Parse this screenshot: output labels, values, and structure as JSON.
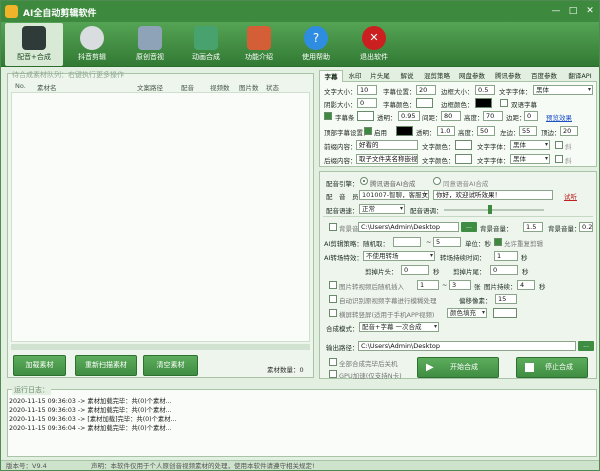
{
  "app": {
    "title": "AI全自动剪辑软件"
  },
  "toolbar": [
    {
      "label": "配音+合成",
      "icon": "clapperboard-icon",
      "color": "#2f3b38"
    },
    {
      "label": "抖音剪辑",
      "icon": "palette-icon",
      "color": "#d9dde0"
    },
    {
      "label": "原创音视",
      "icon": "video-file-icon",
      "color": "#8fa3b8"
    },
    {
      "label": "动画合成",
      "icon": "green-film-icon",
      "color": "#47a26d"
    },
    {
      "label": "功能介绍",
      "icon": "home-icon",
      "color": "#d45f37"
    },
    {
      "label": "使用帮助",
      "icon": "help-icon",
      "color": "#2e8de0"
    },
    {
      "label": "退出软件",
      "icon": "close-icon",
      "color": "#cc1f1f"
    }
  ],
  "queue": {
    "title": "待合成素材队列：右键执行更多操作",
    "columns": [
      "No.",
      "素材名",
      "文案路径",
      "配音",
      "视频数",
      "图片数",
      "状态"
    ],
    "buttons": [
      "加载素材",
      "重新扫描素材",
      "清空素材"
    ],
    "count_label": "素材数量：0"
  },
  "tabs": [
    "字幕",
    "水印",
    "片头尾",
    "解说",
    "混剪策略",
    "网盘参数",
    "腾讯参数",
    "百度参数",
    "翻译API"
  ],
  "subtitle": {
    "font_size_label": "文字大小：",
    "font_size": "10",
    "position_label": "字幕位置：",
    "position": "20",
    "border_size_label": "边框大小：",
    "border_size": "0.5",
    "font_face_label": "文字字体：",
    "font_face": "黑体",
    "shadow_label": "阴影大小：",
    "shadow": "0",
    "color_label": "字幕颜色：",
    "border_color_label": "边框颜色：",
    "double_label": "双语字幕",
    "bg_label": "字幕条",
    "transparency_label": "透明：",
    "transparency": "0.95",
    "spacing_label": "间距：",
    "spacing": "80",
    "height_label": "高度：",
    "height": "70",
    "margin_label": "边距：",
    "margin": "0",
    "preview_link": "预览效果",
    "top_label": "顶部字幕设置：",
    "enable_label": "启用",
    "top_trans_label": "透明：",
    "top_trans": "1.0",
    "top_height_label": "高度：",
    "top_height": "50",
    "left_label": "左边：",
    "left": "55",
    "top_pos_label": "顶边：",
    "top_pos": "20",
    "front_label": "前缀内容：",
    "front": "好看的",
    "front_color_label": "文字颜色：",
    "front_font_label": "文字字体：",
    "front_font": "黑体",
    "back_label": "后缀内容：",
    "back": "取子文件夹名称嵌视",
    "back_color_label": "文字颜色：",
    "back_font_label": "文字字体：",
    "back_font": "黑体",
    "bold_label": "斜"
  },
  "voice": {
    "engine_label": "配音引擎：",
    "engine_opt1": "腾讯语音AI合成",
    "engine_opt2": "同意语音AI合成",
    "speaker_label": "配　音　员：",
    "speaker": "101007-智聊，客服女声",
    "sample_text": "你好，欢迎试听效果！",
    "listen": "试听",
    "speed_label": "配音语速：",
    "speed": "正常",
    "volume_label": "配音语调："
  },
  "mix": {
    "bgm_label": "背景音",
    "bgm_path": "C:\\Users\\Admin\\Desktop",
    "bgm_btn": "...",
    "bgm_vol_label": "背景音量：",
    "bgm_vol": "1.5",
    "bg_vol_label": "背景音量：",
    "bg_vol": "0.2",
    "ai_cut_label": "AI剪辑策略：",
    "random_label": "随机取：",
    "random_to": "~",
    "random_value": "5",
    "unit_label": "单位：秒",
    "allow_repeat": "允许重复剪辑",
    "ai_trans_label": "AI转场特效：",
    "trans_value": "不使用转场",
    "trans_duration_label": "转场持续时间：",
    "trans_duration": "1",
    "trans_unit": "秒",
    "clip_head_label": "剪掉片头：",
    "clip_head": "0",
    "clip_head_unit": "秒",
    "clip_tail_label": "剪掉片尾：",
    "clip_tail": "0",
    "clip_tail_unit": "秒",
    "img_random_label": "图片转视频后随机插入",
    "img_from": "1",
    "img_to": "3",
    "img_unit": "张",
    "img_dur_label": "图片持续：",
    "img_dur": "4",
    "img_dur_unit": "秒",
    "auto_trans_label": "自动识别原视频字幕进行模糊处理",
    "blur_label": "偏移像素：",
    "blur": "15",
    "landscape_label": "横屏转竖屏(适用于手机APP视频)",
    "fill_label": "颜色填充",
    "mode_label": "合成模式：",
    "mode": "配音+字幕 一次合成",
    "output_label": "输出路径：",
    "output": "C:\\Users\\Admin\\Desktop",
    "shutdown_label": "全部合成完毕后关机",
    "gpu_label": "GPU加速(仅支持N卡)",
    "start_btn": "开始合成",
    "stop_btn": "停止合成"
  },
  "log": {
    "title": "运行日志：",
    "lines": [
      "2020-11-15 09:36:03 -> 素材加载完毕：共(0)个素材...",
      "2020-11-15 09:36:03 -> 素材加载完毕：共(0)个素材...",
      "2020-11-15 09:36:03 -> [素材加载]完毕：共(0)个素材...",
      "2020-11-15 09:36:04 -> 素材加载完毕：共(0)个素材..."
    ]
  },
  "status": {
    "version": "版本号：V9.4",
    "notice": "声明：本软件仅用于个人原创音视频素材的处理，使用本软件请遵守相关规定!"
  }
}
